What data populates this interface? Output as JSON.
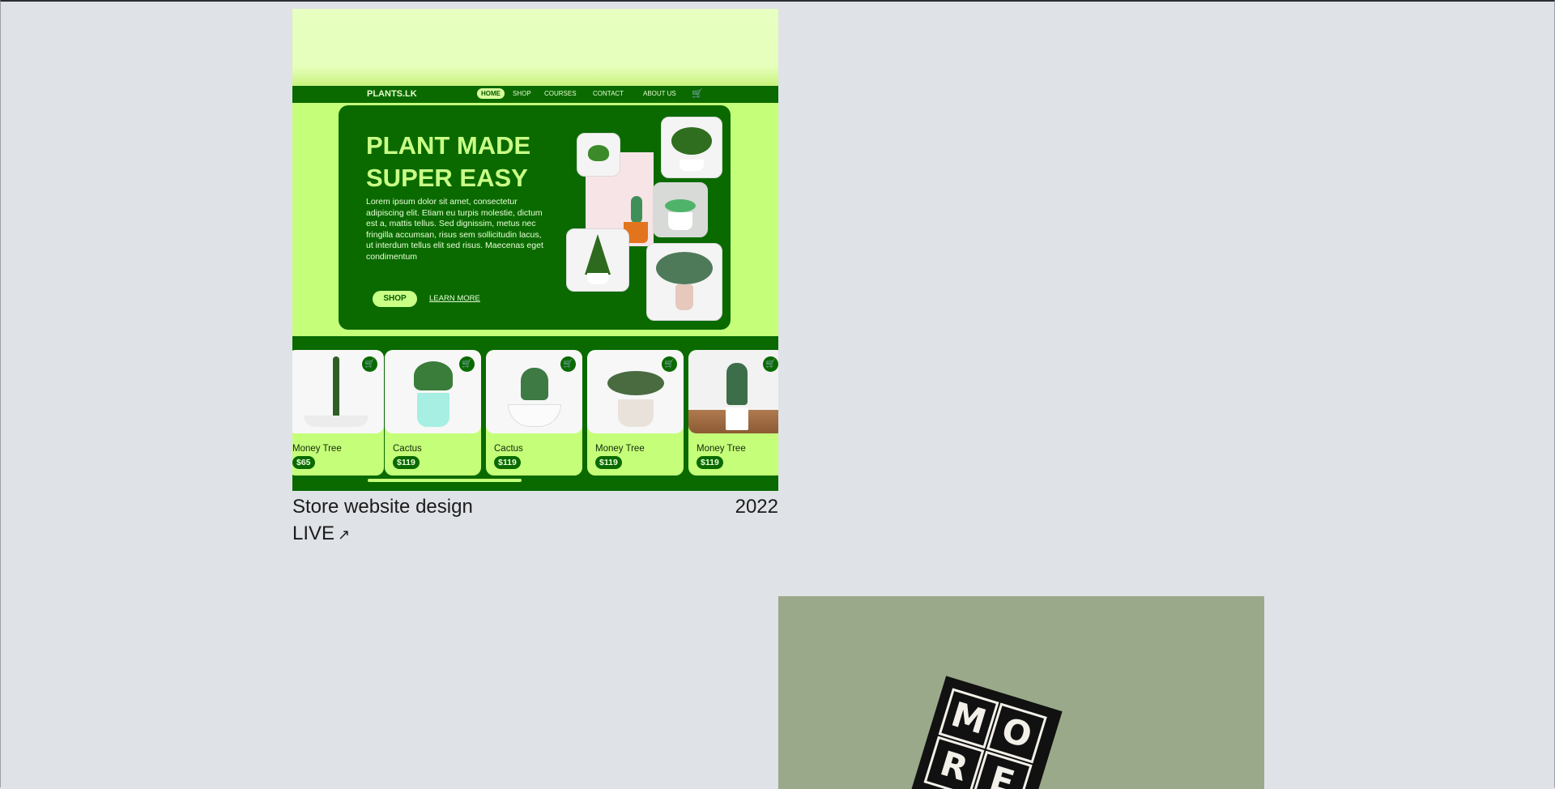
{
  "project": {
    "title": "Store website design",
    "year": "2022",
    "live_label": "LIVE",
    "live_icon": "arrow-up-right-icon"
  },
  "mockup": {
    "brand": "PLANTS.LK",
    "nav": [
      "HOME",
      "SHOP",
      "COURSES",
      "CONTACT",
      "ABOUT US"
    ],
    "hero_title_line1": "PLANT MADE",
    "hero_title_line2": "SUPER EASY",
    "hero_text": "Lorem ipsum dolor sit amet, consectetur adipiscing elit. Etiam eu turpis molestie, dictum est a, mattis tellus. Sed dignissim, metus nec fringilla accumsan, risus sem sollicitudin lacus, ut interdum tellus elit sed risus. Maecenas eget condimentum",
    "shop_label": "SHOP",
    "learn_more_label": "LEARN MORE",
    "products": [
      {
        "name": "Money Tree",
        "price": "$65"
      },
      {
        "name": "Cactus",
        "price": "$119"
      },
      {
        "name": "Cactus",
        "price": "$119"
      },
      {
        "name": "Money Tree",
        "price": "$119"
      },
      {
        "name": "Money Tree",
        "price": "$119"
      }
    ],
    "colors": {
      "dark_green": "#0a6a00",
      "lime": "#c5ff7a",
      "pale_lime": "#e7ffc0"
    }
  },
  "second_project": {
    "tile_letters": [
      "M",
      "O",
      "R",
      "E"
    ],
    "background": "#9aa98a"
  }
}
